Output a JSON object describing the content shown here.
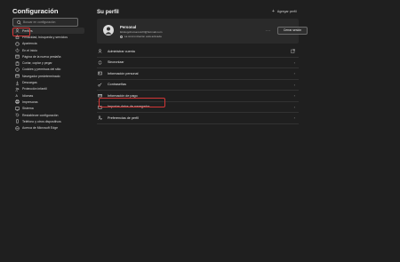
{
  "sidebar": {
    "title": "Configuración",
    "search_placeholder": "Buscar en configuración",
    "items": [
      {
        "label": "Perfiles",
        "icon": "person-icon",
        "active": true
      },
      {
        "label": "Privacidad, búsqueda y servicios",
        "icon": "lock-icon"
      },
      {
        "label": "Apariencia",
        "icon": "palette-icon"
      },
      {
        "label": "En el inicio",
        "icon": "power-icon"
      },
      {
        "label": "Página de la nueva pestaña",
        "icon": "home-tab-icon"
      },
      {
        "label": "Cortar, copiar y pegar",
        "icon": "clipboard-icon"
      },
      {
        "label": "Cookies y permisos del sitio",
        "icon": "cookie-icon"
      },
      {
        "label": "Navegador predeterminado",
        "icon": "browser-icon"
      },
      {
        "label": "Descargas",
        "icon": "download-icon"
      },
      {
        "label": "Protección infantil",
        "icon": "family-icon"
      },
      {
        "label": "Idiomas",
        "icon": "language-icon"
      },
      {
        "label": "Impresoras",
        "icon": "printer-icon"
      },
      {
        "label": "Sistema",
        "icon": "system-icon"
      },
      {
        "label": "Restablecer configuración",
        "icon": "reset-icon"
      },
      {
        "label": "Teléfono y otros dispositivos",
        "icon": "phone-icon"
      },
      {
        "label": "Acerca de Microsoft Edge",
        "icon": "edge-icon"
      }
    ]
  },
  "main": {
    "heading": "Su perfil",
    "add_profile": "Agregar perfil",
    "profile": {
      "name": "Personal",
      "email": "iktiologohumano123@hotmail.com",
      "sync_status": "La sincronización está activada",
      "more": "···",
      "sign_out": "Cerrar sesión"
    },
    "menu": [
      {
        "label": "Administrar cuenta",
        "icon": "account-icon",
        "action": "external-link-icon"
      },
      {
        "label": "Sincronizar",
        "icon": "sync-icon",
        "action": "chevron-right-icon"
      },
      {
        "label": "Información personal",
        "icon": "contact-card-icon",
        "action": "chevron-right-icon"
      },
      {
        "label": "Contraseñas",
        "icon": "key-icon",
        "action": "chevron-right-icon"
      },
      {
        "label": "Información de pago",
        "icon": "credit-card-icon",
        "action": "chevron-right-icon"
      },
      {
        "label": "Importar datos de navegador",
        "icon": "folder-icon",
        "action": "chevron-right-icon"
      },
      {
        "label": "Preferencias de perfil",
        "icon": "profile-settings-icon",
        "action": "chevron-right-icon"
      }
    ]
  },
  "colors": {
    "background": "#1f1f1f",
    "card": "#2a2a2a",
    "highlight": "#d23636",
    "accent": "#7fb3ff"
  }
}
